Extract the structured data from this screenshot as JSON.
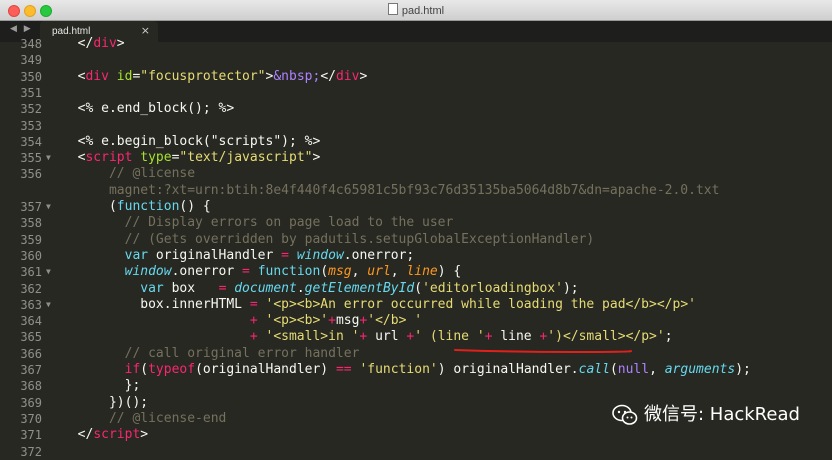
{
  "window": {
    "title": "pad.html"
  },
  "tab": {
    "label": "pad.html",
    "close": "×",
    "nav": "◀ ▶"
  },
  "colors": {
    "background": "#272822",
    "text": "#f8f8f2",
    "tag": "#f92672",
    "attr": "#a6e22e",
    "string": "#e6db74",
    "comment": "#75715e",
    "storage": "#66d9ef",
    "constant": "#ae81ff",
    "underline": "#e0201b"
  },
  "lines": [
    {
      "num": "348",
      "fold": false,
      "tokens": [
        {
          "t": "  ",
          "c": "text"
        },
        {
          "t": "</",
          "c": "text"
        },
        {
          "t": "div",
          "c": "tag"
        },
        {
          "t": ">",
          "c": "text"
        }
      ]
    },
    {
      "num": "349",
      "fold": false,
      "tokens": []
    },
    {
      "num": "350",
      "fold": false,
      "tokens": [
        {
          "t": "  <",
          "c": "text"
        },
        {
          "t": "div",
          "c": "tag"
        },
        {
          "t": " ",
          "c": "text"
        },
        {
          "t": "id",
          "c": "attr"
        },
        {
          "t": "=",
          "c": "text"
        },
        {
          "t": "\"focusprotector\"",
          "c": "string"
        },
        {
          "t": ">",
          "c": "text"
        },
        {
          "t": "&nbsp;",
          "c": "constant"
        },
        {
          "t": "</",
          "c": "text"
        },
        {
          "t": "div",
          "c": "tag"
        },
        {
          "t": ">",
          "c": "text"
        }
      ]
    },
    {
      "num": "351",
      "fold": false,
      "tokens": []
    },
    {
      "num": "352",
      "fold": false,
      "tokens": [
        {
          "t": "  <% e.end_block(); %>",
          "c": "text"
        }
      ]
    },
    {
      "num": "353",
      "fold": false,
      "tokens": []
    },
    {
      "num": "354",
      "fold": false,
      "tokens": [
        {
          "t": "  <% e.begin_block(",
          "c": "text"
        },
        {
          "t": "\"scripts\"",
          "c": "text"
        },
        {
          "t": "); %>",
          "c": "text"
        }
      ]
    },
    {
      "num": "355",
      "fold": true,
      "tokens": [
        {
          "t": "  <",
          "c": "text"
        },
        {
          "t": "script",
          "c": "tag"
        },
        {
          "t": " ",
          "c": "text"
        },
        {
          "t": "type",
          "c": "attr"
        },
        {
          "t": "=",
          "c": "text"
        },
        {
          "t": "\"text/javascript\"",
          "c": "string"
        },
        {
          "t": ">",
          "c": "text"
        }
      ]
    },
    {
      "num": "356",
      "fold": false,
      "tokens": [
        {
          "t": "      // @license",
          "c": "comment"
        }
      ]
    },
    {
      "num": "",
      "fold": false,
      "tokens": [
        {
          "t": "      magnet:?xt=urn:btih:8e4f440f4c65981c5bf93c76d35135ba5064d8b7&dn=apache-2.0.txt",
          "c": "comment"
        }
      ]
    },
    {
      "num": "357",
      "fold": true,
      "tokens": [
        {
          "t": "      (",
          "c": "text"
        },
        {
          "t": "function",
          "c": "storage"
        },
        {
          "t": "() {",
          "c": "text"
        }
      ]
    },
    {
      "num": "358",
      "fold": false,
      "tokens": [
        {
          "t": "        // Display errors on page load to the user",
          "c": "comment"
        }
      ]
    },
    {
      "num": "359",
      "fold": false,
      "tokens": [
        {
          "t": "        // (Gets overridden by padutils.setupGlobalExceptionHandler)",
          "c": "comment"
        }
      ]
    },
    {
      "num": "360",
      "fold": false,
      "tokens": [
        {
          "t": "        ",
          "c": "text"
        },
        {
          "t": "var",
          "c": "storage"
        },
        {
          "t": " originalHandler ",
          "c": "text"
        },
        {
          "t": "=",
          "c": "tag"
        },
        {
          "t": " ",
          "c": "text"
        },
        {
          "t": "window",
          "c": "storage"
        },
        {
          "t": ".onerror;",
          "c": "text"
        }
      ]
    },
    {
      "num": "361",
      "fold": true,
      "tokens": [
        {
          "t": "        ",
          "c": "text"
        },
        {
          "t": "window",
          "c": "storage"
        },
        {
          "t": ".onerror ",
          "c": "text"
        },
        {
          "t": "=",
          "c": "tag"
        },
        {
          "t": " ",
          "c": "text"
        },
        {
          "t": "function",
          "c": "storage"
        },
        {
          "t": "(",
          "c": "text"
        },
        {
          "t": "msg",
          "c": "constant"
        },
        {
          "t": ", ",
          "c": "text"
        },
        {
          "t": "url",
          "c": "constant"
        },
        {
          "t": ", ",
          "c": "text"
        },
        {
          "t": "line",
          "c": "constant"
        },
        {
          "t": ") {",
          "c": "text"
        }
      ]
    },
    {
      "num": "362",
      "fold": false,
      "tokens": [
        {
          "t": "          ",
          "c": "text"
        },
        {
          "t": "var",
          "c": "storage"
        },
        {
          "t": " box   ",
          "c": "text"
        },
        {
          "t": "=",
          "c": "tag"
        },
        {
          "t": " ",
          "c": "text"
        },
        {
          "t": "document",
          "c": "storage"
        },
        {
          "t": ".",
          "c": "text"
        },
        {
          "t": "getElementById",
          "c": "storage"
        },
        {
          "t": "(",
          "c": "text"
        },
        {
          "t": "'editorloadingbox'",
          "c": "string"
        },
        {
          "t": ");",
          "c": "text"
        }
      ]
    },
    {
      "num": "363",
      "fold": true,
      "tokens": [
        {
          "t": "          box.innerHTML ",
          "c": "text"
        },
        {
          "t": "=",
          "c": "tag"
        },
        {
          "t": " ",
          "c": "text"
        },
        {
          "t": "'<p><b>An error occurred while loading the pad</b></p>'",
          "c": "string"
        }
      ]
    },
    {
      "num": "364",
      "fold": false,
      "tokens": [
        {
          "t": "                        ",
          "c": "text"
        },
        {
          "t": "+",
          "c": "tag"
        },
        {
          "t": " ",
          "c": "text"
        },
        {
          "t": "'<p><b>'",
          "c": "string"
        },
        {
          "t": "+",
          "c": "tag"
        },
        {
          "t": "msg",
          "c": "text"
        },
        {
          "t": "+",
          "c": "tag"
        },
        {
          "t": "'</b> '",
          "c": "string"
        }
      ]
    },
    {
      "num": "365",
      "fold": false,
      "tokens": [
        {
          "t": "                        ",
          "c": "text"
        },
        {
          "t": "+",
          "c": "tag"
        },
        {
          "t": " ",
          "c": "text"
        },
        {
          "t": "'<small>in '",
          "c": "string"
        },
        {
          "t": "+",
          "c": "tag"
        },
        {
          "t": " url ",
          "c": "text"
        },
        {
          "t": "+",
          "c": "tag"
        },
        {
          "t": "' (line '",
          "c": "string"
        },
        {
          "t": "+",
          "c": "tag"
        },
        {
          "t": " line ",
          "c": "text"
        },
        {
          "t": "+",
          "c": "tag"
        },
        {
          "t": "')</small></p>'",
          "c": "string"
        },
        {
          "t": ";",
          "c": "text"
        }
      ]
    },
    {
      "num": "366",
      "fold": false,
      "tokens": [
        {
          "t": "        // call original error handler",
          "c": "comment"
        }
      ]
    },
    {
      "num": "367",
      "fold": false,
      "tokens": [
        {
          "t": "        ",
          "c": "text"
        },
        {
          "t": "if",
          "c": "tag"
        },
        {
          "t": "(",
          "c": "text"
        },
        {
          "t": "typeof",
          "c": "tag"
        },
        {
          "t": "(originalHandler) ",
          "c": "text"
        },
        {
          "t": "==",
          "c": "tag"
        },
        {
          "t": " ",
          "c": "text"
        },
        {
          "t": "'function'",
          "c": "string"
        },
        {
          "t": ") originalHandler.",
          "c": "text"
        },
        {
          "t": "call",
          "c": "storage"
        },
        {
          "t": "(",
          "c": "text"
        },
        {
          "t": "null",
          "c": "constant"
        },
        {
          "t": ", ",
          "c": "text"
        },
        {
          "t": "arguments",
          "c": "storage"
        },
        {
          "t": ");",
          "c": "text"
        }
      ]
    },
    {
      "num": "368",
      "fold": false,
      "tokens": [
        {
          "t": "        };",
          "c": "text"
        }
      ]
    },
    {
      "num": "369",
      "fold": false,
      "tokens": [
        {
          "t": "      })();",
          "c": "text"
        }
      ]
    },
    {
      "num": "370",
      "fold": false,
      "tokens": [
        {
          "t": "      // @license-end",
          "c": "comment"
        }
      ]
    },
    {
      "num": "371",
      "fold": false,
      "tokens": [
        {
          "t": "  </",
          "c": "text"
        },
        {
          "t": "script",
          "c": "tag"
        },
        {
          "t": ">",
          "c": "text"
        }
      ]
    },
    {
      "num": "372",
      "fold": false,
      "tokens": []
    }
  ],
  "watermark": {
    "text": "微信号: HackRead"
  }
}
